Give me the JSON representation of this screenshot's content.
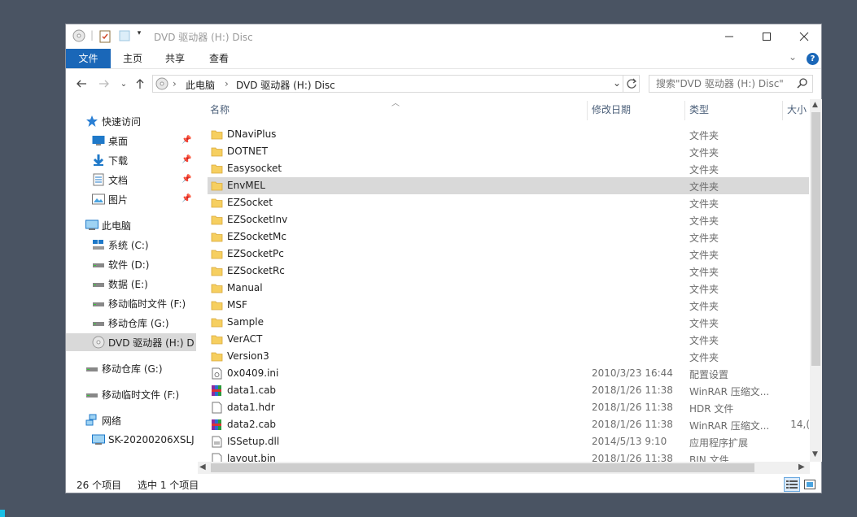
{
  "window": {
    "title": "DVD 驱动器 (H:) Disc"
  },
  "ribbon": {
    "tabs": [
      "文件",
      "主页",
      "共享",
      "查看"
    ]
  },
  "address": {
    "crumbs": [
      "此电脑",
      "DVD 驱动器 (H:) Disc"
    ],
    "search_placeholder": "搜索\"DVD 驱动器 (H:) Disc\""
  },
  "nav": {
    "quick_access": "快速访问",
    "pinned": [
      {
        "label": "桌面",
        "icon": "desktop-icon"
      },
      {
        "label": "下载",
        "icon": "download-icon"
      },
      {
        "label": "文档",
        "icon": "documents-icon"
      },
      {
        "label": "图片",
        "icon": "pictures-icon"
      }
    ],
    "this_pc": "此电脑",
    "drives": [
      {
        "label": "系统 (C:)",
        "icon": "system-drive-icon"
      },
      {
        "label": "软件 (D:)",
        "icon": "drive-icon"
      },
      {
        "label": "数据 (E:)",
        "icon": "drive-icon"
      },
      {
        "label": "移动临时文件 (F:)",
        "icon": "drive-icon"
      },
      {
        "label": "移动仓库 (G:)",
        "icon": "drive-icon"
      },
      {
        "label": "DVD 驱动器 (H:) D",
        "icon": "dvd-drive-icon",
        "selected": true
      }
    ],
    "removable": [
      {
        "label": "移动仓库 (G:)",
        "icon": "drive-icon"
      },
      {
        "label": "移动临时文件 (F:)",
        "icon": "drive-icon"
      }
    ],
    "network": "网络",
    "network_item": "SK-20200206XSLJ"
  },
  "columns": {
    "name": "名称",
    "date": "修改日期",
    "type": "类型",
    "size": "大小"
  },
  "files": [
    {
      "name": "DNaviPlus",
      "date": "",
      "type": "文件夹",
      "size": "",
      "icon": "folder-icon"
    },
    {
      "name": "DOTNET",
      "date": "",
      "type": "文件夹",
      "size": "",
      "icon": "folder-icon"
    },
    {
      "name": "Easysocket",
      "date": "",
      "type": "文件夹",
      "size": "",
      "icon": "folder-icon"
    },
    {
      "name": "EnvMEL",
      "date": "",
      "type": "文件夹",
      "size": "",
      "icon": "folder-icon",
      "selected": true
    },
    {
      "name": "EZSocket",
      "date": "",
      "type": "文件夹",
      "size": "",
      "icon": "folder-icon"
    },
    {
      "name": "EZSocketInv",
      "date": "",
      "type": "文件夹",
      "size": "",
      "icon": "folder-icon"
    },
    {
      "name": "EZSocketMc",
      "date": "",
      "type": "文件夹",
      "size": "",
      "icon": "folder-icon"
    },
    {
      "name": "EZSocketPc",
      "date": "",
      "type": "文件夹",
      "size": "",
      "icon": "folder-icon"
    },
    {
      "name": "EZSocketRc",
      "date": "",
      "type": "文件夹",
      "size": "",
      "icon": "folder-icon"
    },
    {
      "name": "Manual",
      "date": "",
      "type": "文件夹",
      "size": "",
      "icon": "folder-icon"
    },
    {
      "name": "MSF",
      "date": "",
      "type": "文件夹",
      "size": "",
      "icon": "folder-icon"
    },
    {
      "name": "Sample",
      "date": "",
      "type": "文件夹",
      "size": "",
      "icon": "folder-icon"
    },
    {
      "name": "VerACT",
      "date": "",
      "type": "文件夹",
      "size": "",
      "icon": "folder-icon"
    },
    {
      "name": "Version3",
      "date": "",
      "type": "文件夹",
      "size": "",
      "icon": "folder-icon"
    },
    {
      "name": "0x0409.ini",
      "date": "2010/3/23 16:44",
      "type": "配置设置",
      "size": "",
      "icon": "ini-file-icon"
    },
    {
      "name": "data1.cab",
      "date": "2018/1/26 11:38",
      "type": "WinRAR 压缩文...",
      "size": "",
      "icon": "winrar-archive-icon"
    },
    {
      "name": "data1.hdr",
      "date": "2018/1/26 11:38",
      "type": "HDR 文件",
      "size": "",
      "icon": "blank-file-icon"
    },
    {
      "name": "data2.cab",
      "date": "2018/1/26 11:38",
      "type": "WinRAR 压缩文...",
      "size": "14,(",
      "icon": "winrar-archive-icon"
    },
    {
      "name": "ISSetup.dll",
      "date": "2014/5/13 9:10",
      "type": "应用程序扩展",
      "size": "",
      "icon": "dll-file-icon"
    },
    {
      "name": "layout.bin",
      "date": "2018/1/26 11:38",
      "type": "BIN 文件",
      "size": "",
      "icon": "blank-file-icon"
    }
  ],
  "status": {
    "count": "26 个项目",
    "selection": "选中 1 个项目"
  }
}
